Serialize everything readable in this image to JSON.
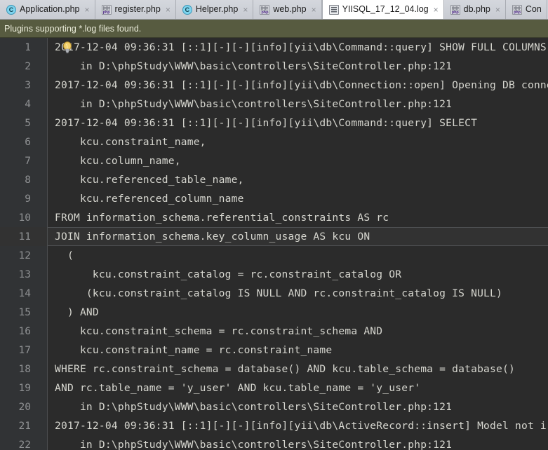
{
  "tabs": [
    {
      "label": "Application.php",
      "icon": "class-icon",
      "active": false,
      "closable": true
    },
    {
      "label": "register.php",
      "icon": "php-file-icon",
      "active": false,
      "closable": true
    },
    {
      "label": "Helper.php",
      "icon": "class-icon",
      "active": false,
      "closable": true
    },
    {
      "label": "web.php",
      "icon": "php-file-icon",
      "active": false,
      "closable": true
    },
    {
      "label": "YIISQL_17_12_04.log",
      "icon": "log-file-icon",
      "active": true,
      "closable": true
    },
    {
      "label": "db.php",
      "icon": "php-file-icon",
      "active": false,
      "closable": true
    },
    {
      "label": "Con",
      "icon": "php-file-icon",
      "active": false,
      "closable": false
    }
  ],
  "tab_close_glyph": "×",
  "notification": {
    "message": "Plugins supporting *.log files found.",
    "background": "#575b40",
    "color": "#e9ead8"
  },
  "editor": {
    "current_line": 11,
    "intention_icon": "lightbulb-icon",
    "intention_line": 10,
    "lines": [
      {
        "n": "1",
        "text": "2017-12-04 09:36:31 [::1][-][-][info][yii\\db\\Command::query] SHOW FULL COLUMNS"
      },
      {
        "n": "2",
        "text": "    in D:\\phpStudy\\WWW\\basic\\controllers\\SiteController.php:121"
      },
      {
        "n": "3",
        "text": "2017-12-04 09:36:31 [::1][-][-][info][yii\\db\\Connection::open] Opening DB conne"
      },
      {
        "n": "4",
        "text": "    in D:\\phpStudy\\WWW\\basic\\controllers\\SiteController.php:121"
      },
      {
        "n": "5",
        "text": "2017-12-04 09:36:31 [::1][-][-][info][yii\\db\\Command::query] SELECT"
      },
      {
        "n": "6",
        "text": "    kcu.constraint_name,"
      },
      {
        "n": "7",
        "text": "    kcu.column_name,"
      },
      {
        "n": "8",
        "text": "    kcu.referenced_table_name,"
      },
      {
        "n": "9",
        "text": "    kcu.referenced_column_name"
      },
      {
        "n": "10",
        "text": "FROM information_schema.referential_constraints AS rc"
      },
      {
        "n": "11",
        "text": "JOIN information_schema.key_column_usage AS kcu ON"
      },
      {
        "n": "12",
        "text": "  ("
      },
      {
        "n": "13",
        "text": "      kcu.constraint_catalog = rc.constraint_catalog OR"
      },
      {
        "n": "14",
        "text": "     (kcu.constraint_catalog IS NULL AND rc.constraint_catalog IS NULL)"
      },
      {
        "n": "15",
        "text": "  ) AND"
      },
      {
        "n": "16",
        "text": "    kcu.constraint_schema = rc.constraint_schema AND"
      },
      {
        "n": "17",
        "text": "    kcu.constraint_name = rc.constraint_name"
      },
      {
        "n": "18",
        "text": "WHERE rc.constraint_schema = database() AND kcu.table_schema = database()"
      },
      {
        "n": "19",
        "text": "AND rc.table_name = 'y_user' AND kcu.table_name = 'y_user'"
      },
      {
        "n": "20",
        "text": "    in D:\\phpStudy\\WWW\\basic\\controllers\\SiteController.php:121"
      },
      {
        "n": "21",
        "text": "2017-12-04 09:36:31 [::1][-][-][info][yii\\db\\ActiveRecord::insert] Model not i"
      },
      {
        "n": "22",
        "text": "    in D:\\phpStudy\\WWW\\basic\\controllers\\SiteController.php:121"
      }
    ]
  },
  "colors": {
    "editor_background": "#2b2b2b",
    "gutter_background": "#313335",
    "current_line_background": "#323232",
    "code_foreground": "#d6d6cf",
    "tabbar_background": "#d6d9df",
    "active_tab_background": "#ffffff"
  }
}
